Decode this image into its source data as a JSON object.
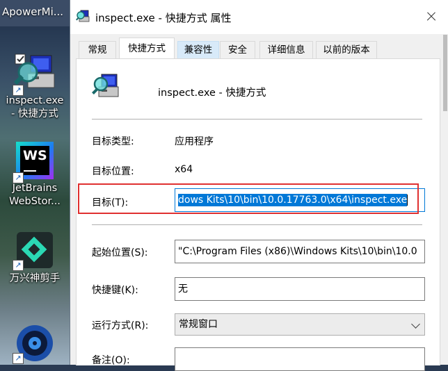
{
  "desktop": {
    "top_app_label": "ApowerMi...",
    "icons": [
      {
        "label_lines": [
          "inspect.exe",
          "- 快捷方式"
        ],
        "icon": "inspect-magnifier-icon"
      },
      {
        "label_lines": [
          "JetBrains",
          "WebStor..."
        ],
        "icon": "webstorm-icon",
        "badge": "WS"
      },
      {
        "label_lines": [
          "万兴神剪手"
        ],
        "icon": "wondershare-filmora-icon"
      },
      {
        "label_lines": [],
        "icon": "disc-app-icon"
      }
    ]
  },
  "dialog": {
    "title": "inspect.exe - 快捷方式 属性",
    "tabs": [
      "常规",
      "快捷方式",
      "兼容性",
      "安全",
      "详细信息",
      "以前的版本"
    ],
    "active_tab": "快捷方式",
    "hovered_tab": "兼容性",
    "heading": "inspect.exe - 快捷方式",
    "rows": {
      "target_type": {
        "label": "目标类型:",
        "value": "应用程序"
      },
      "target_location": {
        "label": "目标位置:",
        "value": "x64"
      },
      "target": {
        "label": "目标(T):",
        "value": "dows Kits\\10\\bin\\10.0.17763.0\\x64\\inspect.exe"
      },
      "start_in": {
        "label": "起始位置(S):",
        "value": "\"C:\\Program Files (x86)\\Windows Kits\\10\\bin\\10.0"
      },
      "shortcut_key": {
        "label": "快捷键(K):",
        "value": "无"
      },
      "run": {
        "label": "运行方式(R):",
        "value": "常规窗口"
      },
      "comment": {
        "label": "备注(O):",
        "value": ""
      }
    },
    "colors": {
      "highlight": "#e03030",
      "selection": "#0078d7",
      "tab_hover": "#d8eaf9"
    }
  }
}
